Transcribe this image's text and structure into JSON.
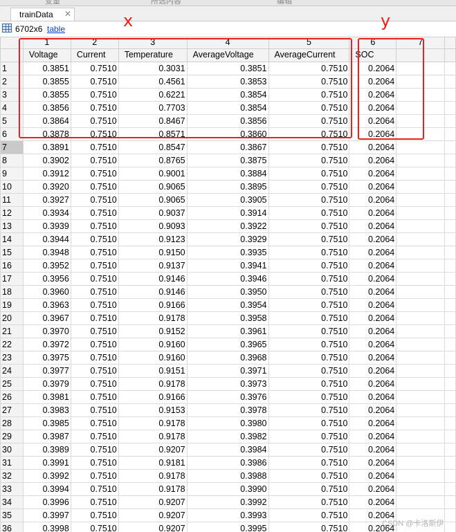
{
  "top_strip": {
    "labels": [
      "变量",
      "所选内容",
      "编辑"
    ]
  },
  "tab": {
    "label": "trainData",
    "close_glyph": "✕"
  },
  "info": {
    "size": "6702x6",
    "link": "table"
  },
  "columns": [
    {
      "num": "1",
      "name": "Voltage"
    },
    {
      "num": "2",
      "name": "Current"
    },
    {
      "num": "3",
      "name": "Temperature"
    },
    {
      "num": "4",
      "name": "AverageVoltage"
    },
    {
      "num": "5",
      "name": "AverageCurrent"
    },
    {
      "num": "6",
      "name": "SOC"
    },
    {
      "num": "7",
      "name": ""
    }
  ],
  "rows": [
    [
      "1",
      "0.3851",
      "0.7510",
      "0.3031",
      "0.3851",
      "0.7510",
      "0.2064"
    ],
    [
      "2",
      "0.3855",
      "0.7510",
      "0.4561",
      "0.3853",
      "0.7510",
      "0.2064"
    ],
    [
      "3",
      "0.3855",
      "0.7510",
      "0.6221",
      "0.3854",
      "0.7510",
      "0.2064"
    ],
    [
      "4",
      "0.3856",
      "0.7510",
      "0.7703",
      "0.3854",
      "0.7510",
      "0.2064"
    ],
    [
      "5",
      "0.3864",
      "0.7510",
      "0.8467",
      "0.3856",
      "0.7510",
      "0.2064"
    ],
    [
      "6",
      "0.3878",
      "0.7510",
      "0.8571",
      "0.3860",
      "0.7510",
      "0.2064"
    ],
    [
      "7",
      "0.3891",
      "0.7510",
      "0.8547",
      "0.3867",
      "0.7510",
      "0.2064"
    ],
    [
      "8",
      "0.3902",
      "0.7510",
      "0.8765",
      "0.3875",
      "0.7510",
      "0.2064"
    ],
    [
      "9",
      "0.3912",
      "0.7510",
      "0.9001",
      "0.3884",
      "0.7510",
      "0.2064"
    ],
    [
      "10",
      "0.3920",
      "0.7510",
      "0.9065",
      "0.3895",
      "0.7510",
      "0.2064"
    ],
    [
      "11",
      "0.3927",
      "0.7510",
      "0.9065",
      "0.3905",
      "0.7510",
      "0.2064"
    ],
    [
      "12",
      "0.3934",
      "0.7510",
      "0.9037",
      "0.3914",
      "0.7510",
      "0.2064"
    ],
    [
      "13",
      "0.3939",
      "0.7510",
      "0.9093",
      "0.3922",
      "0.7510",
      "0.2064"
    ],
    [
      "14",
      "0.3944",
      "0.7510",
      "0.9123",
      "0.3929",
      "0.7510",
      "0.2064"
    ],
    [
      "15",
      "0.3948",
      "0.7510",
      "0.9150",
      "0.3935",
      "0.7510",
      "0.2064"
    ],
    [
      "16",
      "0.3952",
      "0.7510",
      "0.9137",
      "0.3941",
      "0.7510",
      "0.2064"
    ],
    [
      "17",
      "0.3956",
      "0.7510",
      "0.9146",
      "0.3946",
      "0.7510",
      "0.2064"
    ],
    [
      "18",
      "0.3960",
      "0.7510",
      "0.9146",
      "0.3950",
      "0.7510",
      "0.2064"
    ],
    [
      "19",
      "0.3963",
      "0.7510",
      "0.9166",
      "0.3954",
      "0.7510",
      "0.2064"
    ],
    [
      "20",
      "0.3967",
      "0.7510",
      "0.9178",
      "0.3958",
      "0.7510",
      "0.2064"
    ],
    [
      "21",
      "0.3970",
      "0.7510",
      "0.9152",
      "0.3961",
      "0.7510",
      "0.2064"
    ],
    [
      "22",
      "0.3972",
      "0.7510",
      "0.9160",
      "0.3965",
      "0.7510",
      "0.2064"
    ],
    [
      "23",
      "0.3975",
      "0.7510",
      "0.9160",
      "0.3968",
      "0.7510",
      "0.2064"
    ],
    [
      "24",
      "0.3977",
      "0.7510",
      "0.9151",
      "0.3971",
      "0.7510",
      "0.2064"
    ],
    [
      "25",
      "0.3979",
      "0.7510",
      "0.9178",
      "0.3973",
      "0.7510",
      "0.2064"
    ],
    [
      "26",
      "0.3981",
      "0.7510",
      "0.9166",
      "0.3976",
      "0.7510",
      "0.2064"
    ],
    [
      "27",
      "0.3983",
      "0.7510",
      "0.9153",
      "0.3978",
      "0.7510",
      "0.2064"
    ],
    [
      "28",
      "0.3985",
      "0.7510",
      "0.9178",
      "0.3980",
      "0.7510",
      "0.2064"
    ],
    [
      "29",
      "0.3987",
      "0.7510",
      "0.9178",
      "0.3982",
      "0.7510",
      "0.2064"
    ],
    [
      "30",
      "0.3989",
      "0.7510",
      "0.9207",
      "0.3984",
      "0.7510",
      "0.2064"
    ],
    [
      "31",
      "0.3991",
      "0.7510",
      "0.9181",
      "0.3986",
      "0.7510",
      "0.2064"
    ],
    [
      "32",
      "0.3992",
      "0.7510",
      "0.9178",
      "0.3988",
      "0.7510",
      "0.2064"
    ],
    [
      "33",
      "0.3994",
      "0.7510",
      "0.9178",
      "0.3990",
      "0.7510",
      "0.2064"
    ],
    [
      "34",
      "0.3996",
      "0.7510",
      "0.9207",
      "0.3992",
      "0.7510",
      "0.2064"
    ],
    [
      "35",
      "0.3997",
      "0.7510",
      "0.9207",
      "0.3993",
      "0.7510",
      "0.2064"
    ],
    [
      "36",
      "0.3998",
      "0.7510",
      "0.9207",
      "0.3995",
      "0.7510",
      "0.2064"
    ]
  ],
  "selected_row": "7",
  "annotations": {
    "x_label": "x",
    "y_label": "y",
    "color": "#e8211d"
  },
  "watermark": "CSDN @卡洛斯伊"
}
